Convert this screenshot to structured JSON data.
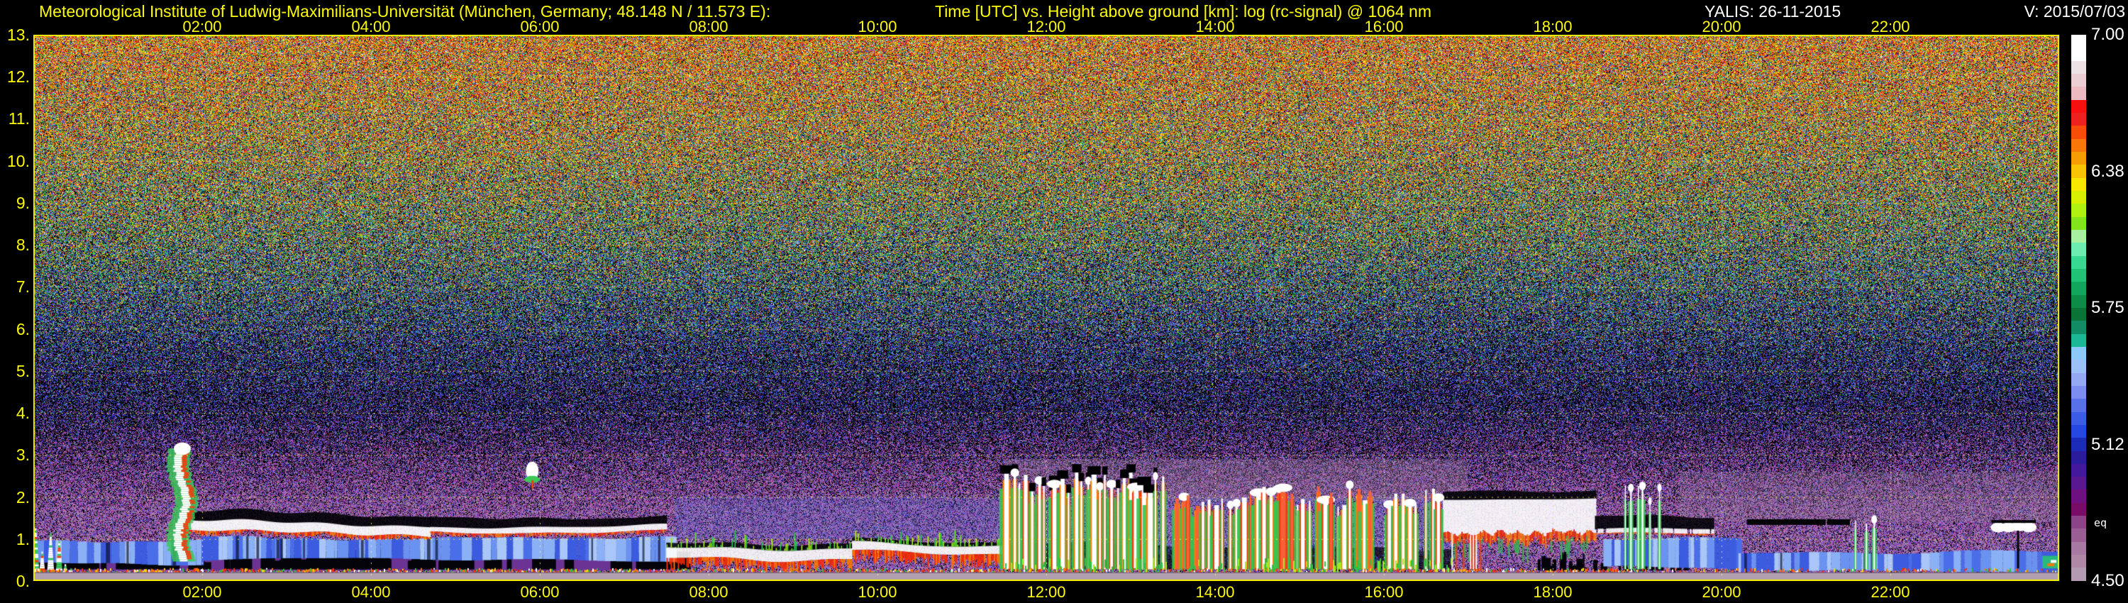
{
  "header": {
    "institute": "Meteorological Institute of Ludwig-Maximilians-Universität (München, Germany; 48.148 N / 11.573 E):",
    "plot_title": "Time [UTC] vs. Height above ground [km]: log (rc-signal) @ 1064 nm",
    "station_date": "YALIS: 26-11-2015",
    "version": "V: 2015/07/03"
  },
  "colors": {
    "axis_text": "#fdfd00",
    "station_text": "#ffffff",
    "background": "#000000",
    "grid": "#f8f850",
    "plot_border": "#f2f200"
  },
  "chart_data": {
    "type": "heatmap",
    "title": "Time [UTC] vs. Height above ground [km]: log (rc-signal) @ 1064 nm",
    "instrument": "YALIS",
    "date": "26-11-2015",
    "xlabel": "Time [UTC]",
    "ylabel": "Height above ground [km]",
    "x_range_hours": [
      0,
      24
    ],
    "x_ticks": [
      {
        "hour": 2,
        "label": "02:00"
      },
      {
        "hour": 4,
        "label": "04:00"
      },
      {
        "hour": 6,
        "label": "06:00"
      },
      {
        "hour": 8,
        "label": "08:00"
      },
      {
        "hour": 10,
        "label": "10:00"
      },
      {
        "hour": 12,
        "label": "12:00"
      },
      {
        "hour": 14,
        "label": "14:00"
      },
      {
        "hour": 16,
        "label": "16:00"
      },
      {
        "hour": 18,
        "label": "18:00"
      },
      {
        "hour": 20,
        "label": "20:00"
      },
      {
        "hour": 22,
        "label": "22:00"
      }
    ],
    "y_range_km": [
      0,
      13
    ],
    "y_ticks": [
      {
        "km": 13,
        "label": "13."
      },
      {
        "km": 12,
        "label": "12."
      },
      {
        "km": 11,
        "label": "11."
      },
      {
        "km": 10,
        "label": "10."
      },
      {
        "km": 9,
        "label": "9."
      },
      {
        "km": 8,
        "label": "8."
      },
      {
        "km": 7,
        "label": "7."
      },
      {
        "km": 6,
        "label": "6."
      },
      {
        "km": 5,
        "label": "5."
      },
      {
        "km": 4,
        "label": "4."
      },
      {
        "km": 3,
        "label": "3."
      },
      {
        "km": 2,
        "label": "2."
      },
      {
        "km": 1,
        "label": "1."
      },
      {
        "km": 0,
        "label": "0."
      }
    ],
    "colorbar": {
      "label": "log (rc-signal) @ 1064 nm",
      "tick_labels": [
        "7.00",
        "6.38",
        "5.75",
        "5.12",
        "4.50"
      ],
      "annotation": "eq",
      "value_range": [
        4.5,
        7.0
      ],
      "colors": [
        "#ffffff",
        "#ffffff",
        "#eee2e4",
        "#eccfd4",
        "#eebac2",
        "#f81010",
        "#ef2020",
        "#f64e08",
        "#f87708",
        "#f89c04",
        "#f8c404",
        "#f8e800",
        "#d8ee00",
        "#aef010",
        "#84e41c",
        "#a8f0a0",
        "#6cecb0",
        "#38d892",
        "#22c276",
        "#12a65c",
        "#0c8c46",
        "#0a7436",
        "#128c64",
        "#1cb896",
        "#8cc8f8",
        "#9cc0f8",
        "#94a8f4",
        "#7c8cf0",
        "#5870e8",
        "#3c5ce8",
        "#2547e0",
        "#1c2cb8",
        "#2b1c9e",
        "#44189c",
        "#5a1890",
        "#6e1080",
        "#780c66",
        "#8c4488",
        "#9a5e95",
        "#a678a2",
        "#ae88a6",
        "#b49ab0"
      ]
    },
    "noise_palette": [
      "#f81008",
      "#aa1e0a",
      "#f87408",
      "#f8b208",
      "#f8ee10",
      "#a5a014",
      "#3cbe46",
      "#14a082",
      "#78bef8",
      "#fcfcfc",
      "#4664f0",
      "#2329b4",
      "#8746aa",
      "#b93ca0",
      "#af87af",
      "#a591a0"
    ],
    "noise_profile": [
      {
        "h": 13.0,
        "d": 0.93,
        "w": [
          16,
          8,
          14,
          12,
          14,
          6,
          8,
          4,
          3,
          4,
          5,
          2,
          3,
          3,
          1,
          0
        ]
      },
      {
        "h": 10.5,
        "d": 0.88,
        "w": [
          10,
          6,
          10,
          10,
          13,
          6,
          15,
          8,
          4,
          3,
          8,
          4,
          4,
          3,
          1,
          0
        ]
      },
      {
        "h": 8.5,
        "d": 0.8,
        "w": [
          5,
          3,
          6,
          7,
          10,
          5,
          20,
          12,
          5,
          2,
          14,
          6,
          5,
          2,
          1,
          0
        ]
      },
      {
        "h": 7.0,
        "d": 0.7,
        "w": [
          2,
          2,
          3,
          4,
          7,
          3,
          18,
          12,
          5,
          1,
          22,
          12,
          8,
          2,
          1,
          0
        ]
      },
      {
        "h": 5.5,
        "d": 0.55,
        "w": [
          1,
          1,
          1,
          1,
          3,
          1,
          10,
          8,
          4,
          1,
          28,
          22,
          15,
          4,
          2,
          1
        ]
      },
      {
        "h": 4.2,
        "d": 0.45,
        "w": [
          0,
          0,
          0,
          0,
          1,
          0,
          4,
          4,
          2,
          0,
          22,
          28,
          25,
          8,
          4,
          2
        ]
      },
      {
        "h": 3.2,
        "d": 0.55,
        "w": [
          0,
          0,
          0,
          0,
          0,
          0,
          1,
          1,
          1,
          0,
          10,
          15,
          35,
          18,
          15,
          4
        ]
      },
      {
        "h": 2.4,
        "d": 0.7,
        "w": [
          0,
          0,
          0,
          0,
          0,
          0,
          1,
          1,
          0,
          0,
          6,
          8,
          38,
          20,
          22,
          5
        ]
      },
      {
        "h": 1.7,
        "d": 0.8,
        "w": [
          0,
          0,
          0,
          0,
          0,
          0,
          0,
          0,
          0,
          0,
          5,
          5,
          35,
          16,
          30,
          9
        ]
      },
      {
        "h": 0.0,
        "d": 0.85,
        "w": [
          0,
          0,
          0,
          0,
          0,
          0,
          0,
          0,
          0,
          0,
          8,
          6,
          30,
          12,
          32,
          12
        ]
      }
    ],
    "features": {
      "overlap_strip": {
        "height_km": [
          0,
          0.19
        ],
        "color": "#b29fae"
      },
      "ground_layer": {
        "height_km": [
          0.19,
          0.34
        ],
        "colors": [
          "#f03010",
          "#f87808",
          "#f8d808",
          "#30c040",
          "#ffffff"
        ]
      },
      "hazes": [
        {
          "t": [
            7.6,
            11.5
          ],
          "height": [
            1.0,
            2.0
          ],
          "color": "rgba(80,110,230,0.22)"
        },
        {
          "t": [
            11.5,
            16.8
          ],
          "height": [
            0.8,
            2.0
          ],
          "color": "rgba(90,120,235,0.25)"
        },
        {
          "t": [
            11.5,
            17.0
          ],
          "height": [
            1.9,
            2.9
          ],
          "color": "rgba(165,140,170,0.30)"
        },
        {
          "t": [
            19.5,
            24.0
          ],
          "height": [
            1.4,
            2.6
          ],
          "color": "rgba(160,135,165,0.22)"
        }
      ],
      "blue_bands": [
        {
          "t": [
            0.0,
            2.0
          ],
          "base": 0.42,
          "top": 1.0
        },
        {
          "t": [
            2.0,
            7.6
          ],
          "base": 0.5,
          "top": 1.05
        },
        {
          "t": [
            18.6,
            20.2
          ],
          "base": 0.3,
          "top": 1.0
        },
        {
          "t": [
            20.2,
            24.0
          ],
          "base": 0.2,
          "top": 0.66
        }
      ],
      "cloud_bands": [
        {
          "t": [
            1.75,
            4.7
          ],
          "center": 1.3,
          "white": 0.26,
          "cap": 0.3,
          "amp": 0.14,
          "red": 0.1
        },
        {
          "t": [
            4.7,
            7.5
          ],
          "center": 1.2,
          "white": 0.18,
          "cap": 0.28,
          "amp": 0.1,
          "red": 0.08
        },
        {
          "t": [
            7.5,
            9.7
          ],
          "center": 0.7,
          "white": 0.3,
          "cap": 0.12,
          "amp": 0.12,
          "red": 0.24,
          "spikes": true
        },
        {
          "t": [
            9.7,
            11.5
          ],
          "center": 0.78,
          "white": 0.26,
          "cap": 0.1,
          "amp": 0.1,
          "red": 0.28,
          "spikes": true
        },
        {
          "t": [
            16.7,
            18.5
          ],
          "center": 1.55,
          "white": 0.85,
          "cap": 0.22,
          "amp": 0.08,
          "red": 0.18,
          "big": true
        },
        {
          "t": [
            18.5,
            19.9
          ],
          "center": 1.17,
          "white": 0.16,
          "cap": 0.3,
          "amp": 0.05,
          "red": 0.04,
          "broken": true
        }
      ],
      "streak_zones": [
        {
          "t": [
            11.5,
            13.4
          ],
          "top": [
            2.1,
            2.6
          ],
          "count": 26,
          "caps": true
        },
        {
          "t": [
            13.5,
            15.9
          ],
          "top": [
            1.7,
            2.3
          ],
          "count": 30,
          "red_bias": true
        },
        {
          "t": [
            16.0,
            16.7
          ],
          "top": [
            1.8,
            2.2
          ],
          "count": 8
        },
        {
          "t": [
            18.8,
            19.3
          ],
          "top": [
            1.9,
            2.3
          ],
          "count": 6,
          "thin": true
        },
        {
          "t": [
            21.55,
            21.85
          ],
          "top": [
            1.3,
            1.5
          ],
          "count": 3,
          "thin": true
        }
      ],
      "plume": {
        "t": [
          1.66,
          1.87
        ],
        "height": [
          0.5,
          3.15
        ]
      },
      "left_spikes": {
        "t": [
          0.02,
          0.55
        ],
        "height": [
          0.2,
          1.3
        ]
      },
      "high_blob": {
        "t": [
          5.82,
          6.0
        ],
        "height": [
          2.45,
          2.9
        ]
      },
      "black_blobs": {
        "times": [
          20.3,
          20.62,
          20.95,
          21.25
        ],
        "height": [
          1.3,
          1.47
        ]
      },
      "white_blobs": {
        "t": [
          23.25,
          23.75
        ],
        "height": [
          1.2,
          1.45
        ]
      },
      "right_edge_blob": {
        "t": [
          23.8,
          24.0
        ],
        "height": [
          0.3,
          0.6
        ]
      }
    }
  }
}
